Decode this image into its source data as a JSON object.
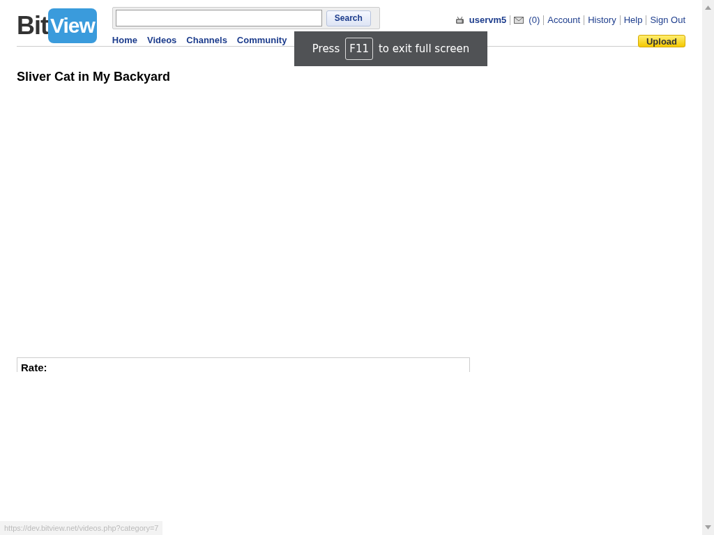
{
  "header": {
    "logo": {
      "part1": "Bit",
      "part2": "View"
    },
    "search": {
      "button": "Search"
    },
    "nav": [
      "Home",
      "Videos",
      "Channels",
      "Community"
    ],
    "user": {
      "name": "uservm5",
      "messages": "(0)",
      "links": [
        "Account",
        "History",
        "Help",
        "Sign Out"
      ]
    },
    "upload": "Upload"
  },
  "toast": {
    "before": "Press",
    "key": "F11",
    "after": "to exit full screen"
  },
  "video": {
    "title": "Sliver Cat in My Backyard",
    "rate_label": "Rate:"
  },
  "status_bar": {
    "url": "https://dev.bitview.net/videos.php?category=7"
  }
}
